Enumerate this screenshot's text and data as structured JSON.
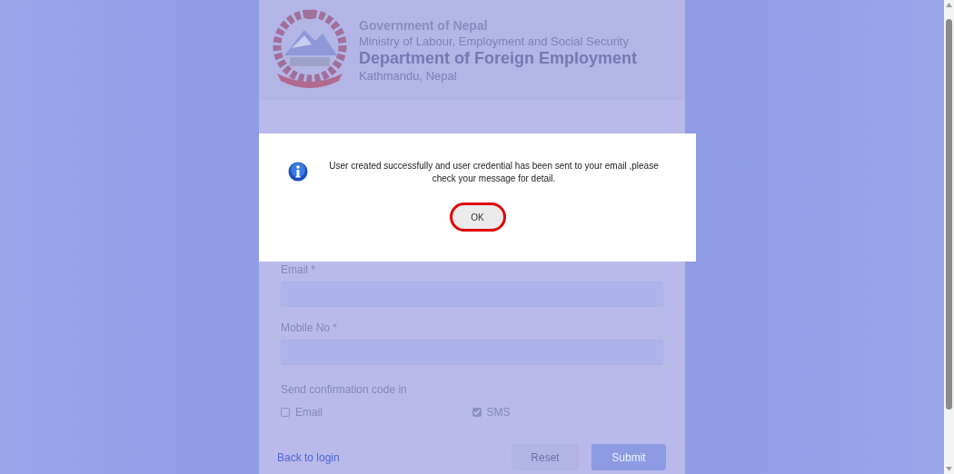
{
  "header": {
    "line_1": "Government of Nepal",
    "line_2": "Ministry of Labour, Employment and Social Security",
    "line_3": "Department of Foreign Employment",
    "line_4": "Kathmandu, Nepal"
  },
  "form": {
    "fields": [
      {
        "label": "Email *"
      },
      {
        "label": "Mobile No *"
      }
    ],
    "confirmation": {
      "label": "Send confirmation code in",
      "options": [
        {
          "label": "Email",
          "checked": false
        },
        {
          "label": "SMS",
          "checked": true
        }
      ]
    },
    "back_link": "Back to login",
    "buttons": [
      {
        "label": "Reset",
        "kind": "secondary"
      },
      {
        "label": "Submit",
        "kind": "primary"
      }
    ]
  },
  "dialog": {
    "message": "User created successfully and user credential has been sent to your email ,please check your message for detail.",
    "button": "OK"
  }
}
